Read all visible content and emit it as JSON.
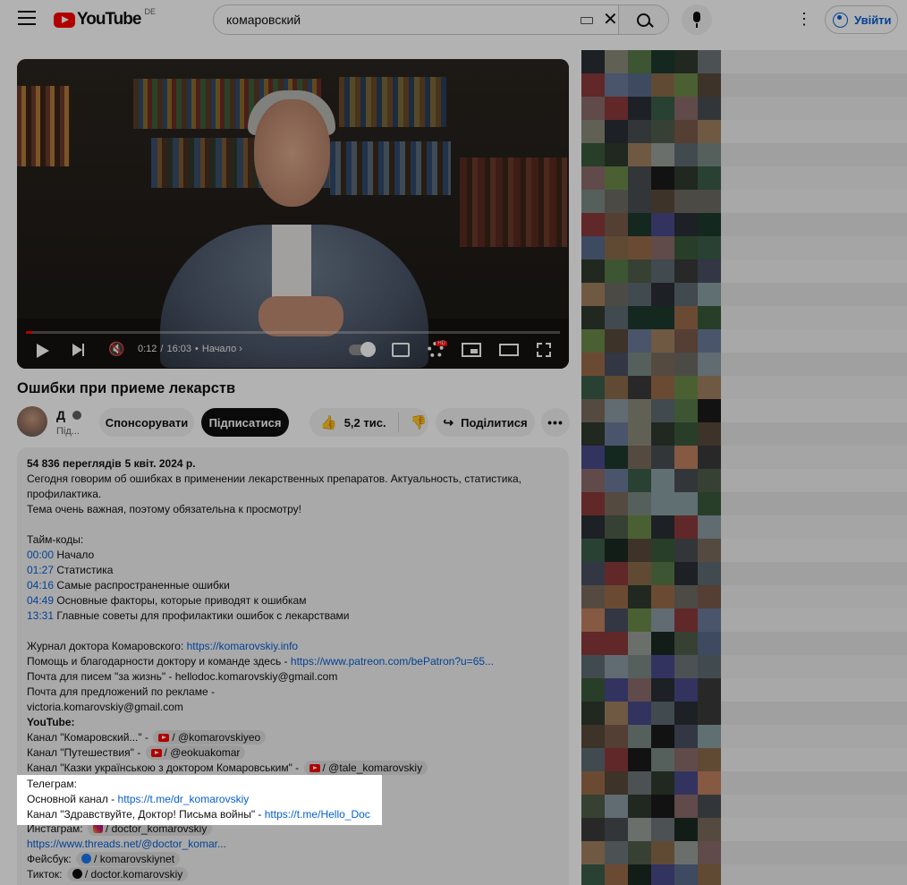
{
  "header": {
    "logo_text": "YouTube",
    "logo_country": "DE",
    "search_value": "комаровский",
    "signin_label": "Увійти"
  },
  "player": {
    "current_time": "0:12",
    "duration": "16:03",
    "chapter": "Начало",
    "progress_fraction": 0.0125
  },
  "video": {
    "title": "Ошибки при приеме лекарств",
    "channel_name": "Д",
    "subscribers": "Під...",
    "sponsor_label": "Спонсорувати",
    "subscribe_label": "Підписатися",
    "likes": "5,2 тис.",
    "share_label": "Поділитися"
  },
  "description": {
    "views": "54 836 переглядів",
    "date": "5 квіт. 2024 р.",
    "intro": [
      "Сегодня говорим об ошибках в применении лекарственных препаратов. Актуальность, статистика,",
      "профилактика.",
      "Тема очень важная, поэтому обязательна к просмотру!"
    ],
    "timecodes_title": "Тайм-коды:",
    "timecodes": [
      {
        "time": "00:00",
        "label": "Начало"
      },
      {
        "time": "01:27",
        "label": "Статистика"
      },
      {
        "time": "04:16",
        "label": "Самые распространенные ошибки"
      },
      {
        "time": "04:49",
        "label": "Основные факторы, которые приводят к ошибкам"
      },
      {
        "time": "13:31",
        "label": "Главные советы для профилактики ошибок с лекарствами"
      }
    ],
    "journal_label": "Журнал доктора Комаровского:",
    "journal_link": "https://komarovskiy.info",
    "help_label": "Помощь и благодарности доктору и  команде здесь -",
    "help_link": "https://www.patreon.com/bePatron?u=65...",
    "mail_life": "Почта для писем \"за жизнь\" - hellodoc.komarovskiy@gmail.com",
    "mail_ads_1": "Почта для предложений по рекламе -",
    "mail_ads_2": "victoria.komarovskiy@gmail.com",
    "youtube_title": "YouTube:",
    "yt_channels": [
      {
        "label": "Канал \"Комаровский...\" -",
        "handle": "/ @komarovskiyeo"
      },
      {
        "label": "Канал \"Путешествия\" -",
        "handle": "/ @eokuakomar"
      },
      {
        "label": "Канал \"Казки українською з доктором Комаровським\" -",
        "handle": "/ @tale_komarovskiy"
      }
    ],
    "telegram_title": "Телеграм:",
    "tg_main_label": "Основной  канал -",
    "tg_main_link": "https://t.me/dr_komarovskiy",
    "tg_letters_label": "Канал \"Здравствуйте, Доктор! Письма войны\" -",
    "tg_letters_link": "https://t.me/Hello_Doc",
    "instagram_label": "Инстаграм:",
    "instagram_handle": "/ doctor_komarovskiy",
    "threads_link": "https://www.threads.net/@doctor_komar...",
    "facebook_label": "Фейсбук:",
    "facebook_handle": "/ komarovskiynet",
    "tiktok_label": "Тикток:",
    "tiktok_handle": "/ doctor.komarovskiy"
  },
  "colors": {
    "brand_red": "#ff0000",
    "link_blue": "#065fd4"
  },
  "icons": [
    "menu-icon",
    "youtube-logo-icon",
    "keyboard-icon",
    "clear-icon",
    "search-icon",
    "mic-icon",
    "more-vert-icon",
    "account-icon",
    "play-icon",
    "next-icon",
    "mute-icon",
    "autoplay-toggle-icon",
    "subtitles-icon",
    "settings-icon",
    "miniplayer-icon",
    "theater-icon",
    "fullscreen-icon",
    "verified-icon",
    "like-icon",
    "dislike-icon",
    "share-icon",
    "more-horiz-icon"
  ]
}
